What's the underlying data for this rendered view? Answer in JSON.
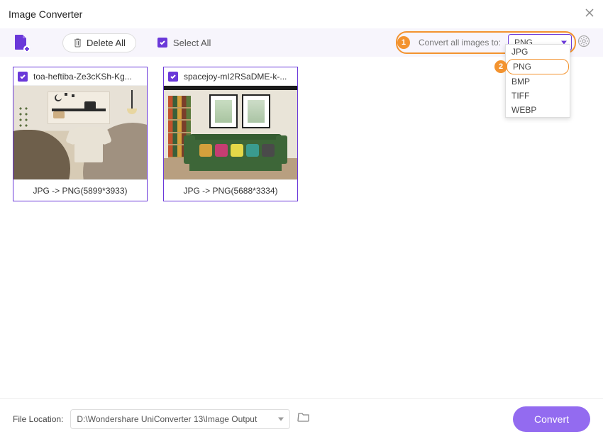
{
  "window": {
    "title": "Image Converter"
  },
  "toolbar": {
    "delete_all_label": "Delete All",
    "select_all_label": "Select All",
    "convert_to_label": "Convert all images to:",
    "format_selected": "PNG",
    "format_options": [
      "JPG",
      "PNG",
      "BMP",
      "TIFF",
      "WEBP"
    ]
  },
  "annotation": {
    "step1": "1",
    "step2": "2"
  },
  "cards": [
    {
      "filename": "toa-heftiba-Ze3cKSh-Kg...",
      "conversion": "JPG -> PNG(5899*3933)"
    },
    {
      "filename": "spacejoy-mI2RSaDME-k-...",
      "conversion": "JPG -> PNG(5688*3334)"
    }
  ],
  "footer": {
    "location_label": "File Location:",
    "path": "D:\\Wondershare UniConverter 13\\Image Output",
    "convert_label": "Convert"
  }
}
